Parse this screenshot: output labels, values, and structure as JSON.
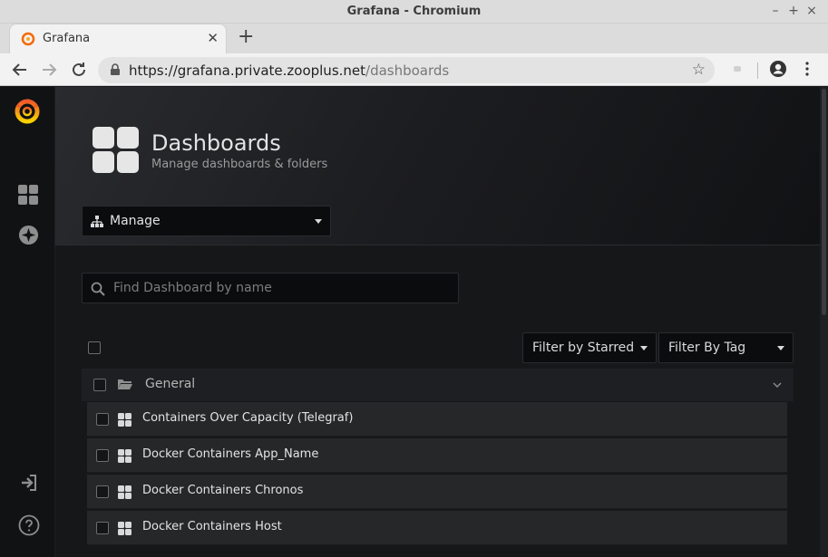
{
  "window": {
    "title": "Grafana - Chromium"
  },
  "browser": {
    "tab_title": "Grafana",
    "url_host": "https://grafana.private.zooplus.net",
    "url_path": "/dashboards"
  },
  "page": {
    "title": "Dashboards",
    "subtitle": "Manage dashboards & folders",
    "nav_selected": "Manage"
  },
  "search": {
    "placeholder": "Find Dashboard by name",
    "value": ""
  },
  "filters": {
    "starred_label": "Filter by Starred",
    "tag_label": "Filter By Tag"
  },
  "folder": {
    "name": "General"
  },
  "dashboards": [
    {
      "title": "Containers Over Capacity (Telegraf)"
    },
    {
      "title": "Docker Containers App_Name"
    },
    {
      "title": "Docker Containers Chronos"
    },
    {
      "title": "Docker Containers Host"
    }
  ],
  "colors": {
    "brand": "#f46800",
    "background": "#161719",
    "row": "#262729"
  },
  "icons": {
    "sidebar": [
      "grafana-logo-icon",
      "dashboards-icon",
      "explore-icon",
      "sign-in-icon",
      "help-icon"
    ]
  }
}
